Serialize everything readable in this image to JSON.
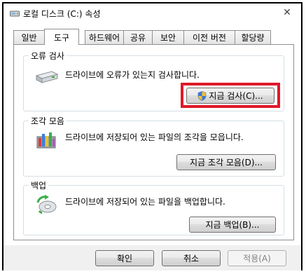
{
  "window": {
    "title": "로컬 디스크 (C:) 속성",
    "close_glyph": "✕"
  },
  "tabs": [
    {
      "label": "일반",
      "active": false
    },
    {
      "label": "도구",
      "active": true
    },
    {
      "label": "하드웨어",
      "active": false
    },
    {
      "label": "공유",
      "active": false
    },
    {
      "label": "보안",
      "active": false
    },
    {
      "label": "이전 버전",
      "active": false
    },
    {
      "label": "할당량",
      "active": false
    }
  ],
  "error_check": {
    "title": "오류 검사",
    "description": "드라이브에 오류가 있는지 검사합니다.",
    "button_label": "지금 검사(C)...",
    "icon": "hard-drive-icon",
    "highlight_color": "#e0192a"
  },
  "defrag": {
    "title": "조각 모음",
    "description": "드라이브에 저장되어 있는 파일의 조각을 모읍니다.",
    "button_label": "지금 조각 모음(D)...",
    "icon": "defrag-icon"
  },
  "backup": {
    "title": "백업",
    "description": "드라이브에 저장되어 있는 파일을 백업합니다.",
    "button_label": "지금 백업(B)...",
    "icon": "backup-icon"
  },
  "footer": {
    "ok_label": "확인",
    "cancel_label": "취소",
    "apply_label": "적용(A)"
  }
}
